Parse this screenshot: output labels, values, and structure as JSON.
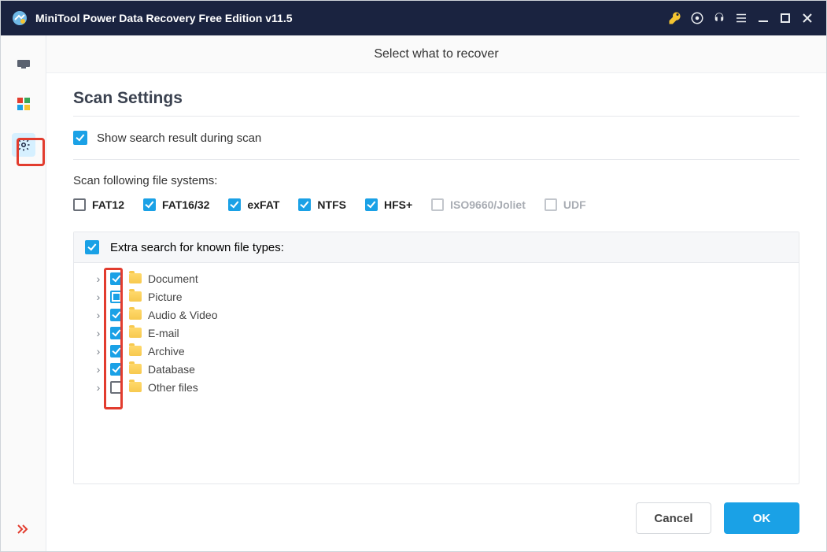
{
  "title": "MiniTool Power Data Recovery Free Edition v11.5",
  "page_title": "Select what to recover",
  "section_title": "Scan Settings",
  "show_results_label": "Show search result during scan",
  "show_results_checked": true,
  "fs_heading": "Scan following file systems:",
  "filesystems": [
    {
      "label": "FAT12",
      "state": "unchecked",
      "disabled": false
    },
    {
      "label": "FAT16/32",
      "state": "checked",
      "disabled": false
    },
    {
      "label": "exFAT",
      "state": "checked",
      "disabled": false
    },
    {
      "label": "NTFS",
      "state": "checked",
      "disabled": false
    },
    {
      "label": "HFS+",
      "state": "checked",
      "disabled": false
    },
    {
      "label": "ISO9660/Joliet",
      "state": "unchecked",
      "disabled": true
    },
    {
      "label": "UDF",
      "state": "unchecked",
      "disabled": true
    }
  ],
  "extra_search_label": "Extra search for known file types:",
  "extra_search_checked": true,
  "file_types": [
    {
      "label": "Document",
      "state": "checked"
    },
    {
      "label": "Picture",
      "state": "partial"
    },
    {
      "label": "Audio & Video",
      "state": "checked"
    },
    {
      "label": "E-mail",
      "state": "checked"
    },
    {
      "label": "Archive",
      "state": "checked"
    },
    {
      "label": "Database",
      "state": "checked"
    },
    {
      "label": "Other files",
      "state": "unchecked"
    }
  ],
  "buttons": {
    "cancel": "Cancel",
    "ok": "OK"
  },
  "colors": {
    "accent": "#1aa1e6",
    "highlight": "#e23c2e",
    "titlebar": "#1a2340"
  }
}
